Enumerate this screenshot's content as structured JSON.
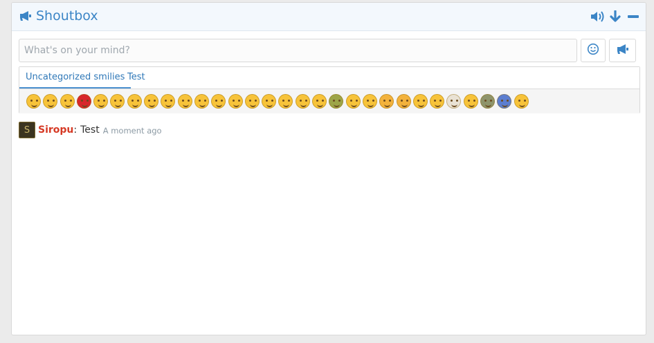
{
  "header": {
    "title": "Shoutbox",
    "title_icon": "megaphone-icon",
    "controls": [
      "volume-icon",
      "arrow-down-icon",
      "minimize-icon"
    ]
  },
  "input": {
    "placeholder": "What's on your mind?",
    "value": ""
  },
  "buttons": {
    "smiley": "smiley-icon",
    "send": "megaphone-icon"
  },
  "smilies": {
    "tabs": [
      {
        "label": "Uncategorized smilies",
        "active": true
      },
      {
        "label": "Test",
        "active": false
      }
    ],
    "items": [
      {
        "name": "smile",
        "color": "#f7c33a"
      },
      {
        "name": "wink",
        "color": "#f7c33a"
      },
      {
        "name": "frown",
        "color": "#f7c33a"
      },
      {
        "name": "mad",
        "color": "#d8262c"
      },
      {
        "name": "confused",
        "color": "#f7c33a"
      },
      {
        "name": "cool",
        "color": "#f7c33a"
      },
      {
        "name": "tongue",
        "color": "#f7c33a"
      },
      {
        "name": "laugh",
        "color": "#f7c33a"
      },
      {
        "name": "eek",
        "color": "#f7c33a"
      },
      {
        "name": "oops",
        "color": "#f7c33a"
      },
      {
        "name": "roll-eyes",
        "color": "#f7c33a"
      },
      {
        "name": "dizzy",
        "color": "#f7c33a"
      },
      {
        "name": "unamused",
        "color": "#f7c33a"
      },
      {
        "name": "zipper",
        "color": "#f7c33a"
      },
      {
        "name": "cry",
        "color": "#f7c33a"
      },
      {
        "name": "love",
        "color": "#f7c33a"
      },
      {
        "name": "grin-squint",
        "color": "#f7c33a"
      },
      {
        "name": "rofl",
        "color": "#f7c33a"
      },
      {
        "name": "sick",
        "color": "#9da548"
      },
      {
        "name": "sleeping",
        "color": "#f7c33a"
      },
      {
        "name": "smirk",
        "color": "#f7c33a"
      },
      {
        "name": "thumbs-up",
        "color": "#f3b23c"
      },
      {
        "name": "thumbs-down",
        "color": "#f3b23c"
      },
      {
        "name": "kiss",
        "color": "#f7c33a"
      },
      {
        "name": "thinking",
        "color": "#f7c33a"
      },
      {
        "name": "coffee",
        "color": "#e9e2d4"
      },
      {
        "name": "blush",
        "color": "#f7c33a"
      },
      {
        "name": "alien",
        "color": "#8e946b"
      },
      {
        "name": "devil",
        "color": "#5c7ed0"
      },
      {
        "name": "nerd",
        "color": "#f7c33a"
      }
    ]
  },
  "messages": [
    {
      "avatar_letter": "S",
      "username": "Siropu",
      "separator": ":",
      "text": "Test",
      "time": "A moment ago"
    }
  ],
  "colors": {
    "accent": "#3b85c6",
    "username": "#d63a25",
    "time": "#8c9aa4"
  }
}
